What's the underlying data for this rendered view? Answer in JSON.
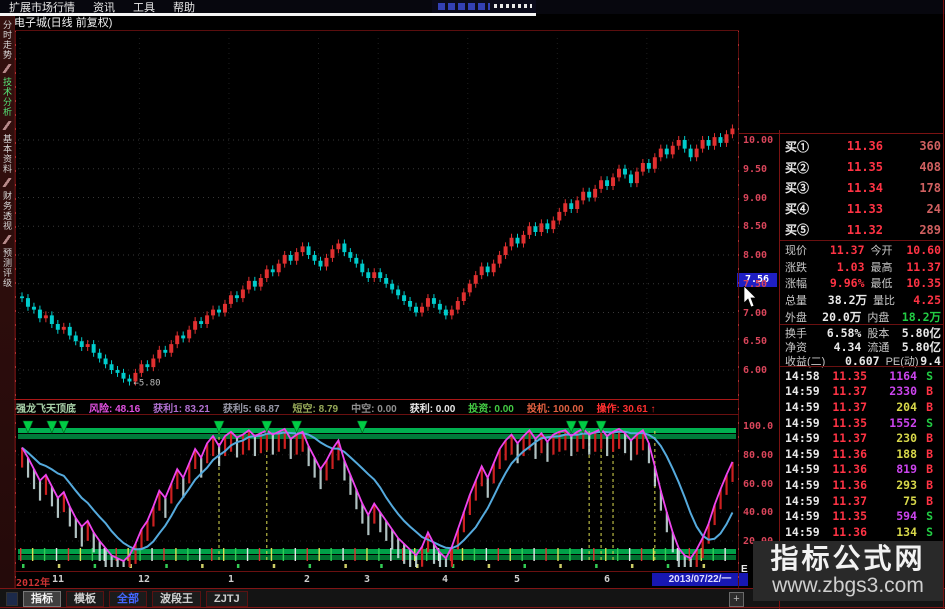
{
  "menu": [
    "扩展市场行情",
    "资讯",
    "工具",
    "帮助"
  ],
  "title_bar": {
    "stock_title": "电子城(日线 前复权)"
  },
  "sidebar": {
    "tabs": [
      {
        "label": "分时走势",
        "active": false
      },
      {
        "label": "技术分析",
        "active": true
      },
      {
        "label": "基本资料",
        "active": false
      },
      {
        "label": "财务透视",
        "active": false
      },
      {
        "label": "预测评级",
        "active": false
      }
    ]
  },
  "colors": {
    "up": "#ff3344",
    "down": "#22cc44",
    "neutral": "#e8e8e8",
    "vol_big": "#cc44ee",
    "vol_small": "#d8d84a",
    "buy_vol": "#d06060"
  },
  "chart_data": [
    {
      "type": "candlestick",
      "title": "电子城(日线 前复权)",
      "ylabel": "价格",
      "y_ticks": [
        10.0,
        9.5,
        9.0,
        8.5,
        8.0,
        7.5,
        7.0,
        6.5,
        6.0
      ],
      "y_tick_labels": [
        "10.00",
        "9.50",
        "9.00",
        "8.50",
        "8.00",
        "7.50",
        "7.00",
        "6.50",
        "6.00"
      ],
      "ylim": [
        5.6,
        11.9
      ],
      "grid": true,
      "low_annotation": {
        "label": "←5.80",
        "index": 18,
        "value": 5.8
      },
      "current_tag": {
        "label": "7.56",
        "value": 7.56
      },
      "month_start_indices": [
        0,
        20,
        35,
        50,
        60,
        75,
        90,
        105
      ],
      "closes": [
        7.25,
        7.1,
        7.05,
        6.9,
        6.95,
        6.8,
        6.7,
        6.75,
        6.6,
        6.5,
        6.4,
        6.45,
        6.3,
        6.2,
        6.1,
        6.0,
        5.95,
        5.85,
        5.8,
        5.95,
        6.1,
        6.05,
        6.2,
        6.35,
        6.3,
        6.45,
        6.6,
        6.55,
        6.7,
        6.85,
        6.8,
        6.95,
        7.05,
        7.0,
        7.15,
        7.3,
        7.25,
        7.4,
        7.55,
        7.45,
        7.6,
        7.75,
        7.7,
        7.85,
        8.0,
        7.9,
        8.05,
        8.15,
        8.0,
        7.9,
        7.8,
        7.95,
        8.1,
        8.2,
        8.05,
        7.95,
        7.85,
        7.7,
        7.6,
        7.7,
        7.6,
        7.5,
        7.4,
        7.3,
        7.2,
        7.1,
        7.0,
        7.1,
        7.25,
        7.15,
        7.05,
        6.95,
        7.05,
        7.2,
        7.35,
        7.5,
        7.65,
        7.8,
        7.7,
        7.85,
        8.0,
        8.15,
        8.3,
        8.2,
        8.35,
        8.5,
        8.4,
        8.55,
        8.45,
        8.6,
        8.75,
        8.9,
        8.8,
        8.95,
        9.1,
        9.0,
        9.15,
        9.3,
        9.2,
        9.35,
        9.5,
        9.4,
        9.25,
        9.45,
        9.6,
        9.5,
        9.7,
        9.85,
        9.75,
        9.9,
        10.0,
        9.85,
        9.7,
        9.85,
        10.0,
        9.9,
        10.05,
        9.95,
        10.1,
        10.2
      ],
      "x_ticks": [
        {
          "label": "2012年",
          "x": 2,
          "color": "#cc3333"
        },
        {
          "label": "11",
          "x": 38,
          "color": "#cfcfcf"
        },
        {
          "label": "12",
          "x": 124,
          "color": "#cfcfcf"
        },
        {
          "label": "1",
          "x": 214,
          "color": "#cfcfcf"
        },
        {
          "label": "2",
          "x": 290,
          "color": "#cfcfcf"
        },
        {
          "label": "3",
          "x": 350,
          "color": "#cfcfcf"
        },
        {
          "label": "4",
          "x": 428,
          "color": "#cfcfcf"
        },
        {
          "label": "5",
          "x": 500,
          "color": "#cfcfcf"
        },
        {
          "label": "6",
          "x": 590,
          "color": "#cfcfcf"
        }
      ],
      "date_box_label": "2013/07/22/一",
      "edge_label": "E"
    },
    {
      "type": "line+histogram",
      "title": "强龙飞天顶底",
      "y_ticks": [
        100.0,
        80.0,
        60.0,
        40.0,
        20.0
      ],
      "y_tick_labels": [
        "100.0",
        "80.00",
        "60.00",
        "40.00",
        "20.00"
      ],
      "ylim": [
        0,
        100
      ],
      "legend_position": "none",
      "series": [
        {
          "name": "操作线",
          "color": "#ee44ee",
          "values": [
            85,
            78,
            70,
            62,
            66,
            58,
            50,
            54,
            44,
            36,
            30,
            34,
            26,
            20,
            15,
            10,
            8,
            6,
            10,
            18,
            28,
            34,
            44,
            55,
            50,
            60,
            70,
            64,
            74,
            84,
            78,
            88,
            93,
            86,
            93,
            96,
            92,
            94,
            97,
            93,
            95,
            97,
            94,
            96,
            98,
            91,
            94,
            96,
            86,
            78,
            70,
            76,
            84,
            90,
            76,
            66,
            56,
            46,
            38,
            46,
            40,
            34,
            28,
            22,
            18,
            14,
            10,
            16,
            26,
            18,
            12,
            8,
            16,
            28,
            40,
            52,
            62,
            72,
            64,
            74,
            84,
            90,
            94,
            88,
            93,
            97,
            91,
            95,
            89,
            94,
            96,
            97,
            93,
            96,
            98,
            94,
            96,
            98,
            93,
            96,
            98,
            95,
            90,
            94,
            97,
            88,
            72,
            55,
            40,
            26,
            15,
            10,
            8,
            14,
            22,
            32,
            45,
            56,
            66,
            75
          ]
        },
        {
          "name": "慢线",
          "color": "#55aadd",
          "derived": "sma",
          "window": 8
        }
      ],
      "markers": {
        "sell_triangle_indices": [
          1,
          5,
          7,
          33,
          41,
          46,
          57,
          92,
          94,
          97
        ],
        "yellow_dash_indices": [
          33,
          41,
          95,
          97,
          99,
          106
        ]
      },
      "bands": {
        "top_band": true,
        "bottom_band": true
      }
    }
  ],
  "param_line": {
    "items": [
      {
        "text": "强龙飞天顶底",
        "color": "#a8d0a8"
      },
      {
        "text": "风险: 48.16",
        "color": "#e050e0"
      },
      {
        "text": "获利1: 83.21",
        "color": "#b070d0"
      },
      {
        "text": "获利5: 68.87",
        "color": "#9898a8"
      },
      {
        "text": "短空: 8.79",
        "color": "#96a858"
      },
      {
        "text": "中空: 0.00",
        "color": "#909090"
      },
      {
        "text": "获利: 0.00",
        "color": "#e8e8e8"
      },
      {
        "text": "投资: 0.00",
        "color": "#44cc44"
      },
      {
        "text": "投机: 100.00",
        "color": "#e06040"
      },
      {
        "text": "操作: 30.61 ↑",
        "color": "#ff3030"
      }
    ]
  },
  "right_panel": {
    "buy_rows": [
      {
        "label": "买①",
        "price": "11.36",
        "vol": "360"
      },
      {
        "label": "买②",
        "price": "11.35",
        "vol": "408"
      },
      {
        "label": "买③",
        "price": "11.34",
        "vol": "178"
      },
      {
        "label": "买④",
        "price": "11.33",
        "vol": "24"
      },
      {
        "label": "买⑤",
        "price": "11.32",
        "vol": "289"
      }
    ],
    "info_rows": [
      {
        "l1": "现价",
        "v1": "11.37",
        "c1": "up",
        "l2": "今开",
        "v2": "10.60",
        "c2": "up"
      },
      {
        "l1": "涨跌",
        "v1": "1.03",
        "c1": "up",
        "l2": "最高",
        "v2": "11.37",
        "c2": "up"
      },
      {
        "l1": "涨幅",
        "v1": "9.96%",
        "c1": "up",
        "l2": "最低",
        "v2": "10.35",
        "c2": "up"
      },
      {
        "l1": "总量",
        "v1": "38.2万",
        "c1": "neutral",
        "l2": "量比",
        "v2": "4.25",
        "c2": "up"
      },
      {
        "l1": "外盘",
        "v1": "20.0万",
        "c1": "neutral",
        "l2": "内盘",
        "v2": "18.2万",
        "c2": "down"
      }
    ],
    "info_rows2": [
      {
        "l1": "换手",
        "v1": "6.58%",
        "c1": "neutral",
        "l2": "股本",
        "v2": "5.80亿",
        "c2": "neutral"
      },
      {
        "l1": "净资",
        "v1": "4.34",
        "c1": "neutral",
        "l2": "流通",
        "v2": "5.80亿",
        "c2": "neutral"
      },
      {
        "l1": "收益(二)",
        "v1": "0.607",
        "c1": "neutral",
        "l2": "PE(动)",
        "v2": "9.4",
        "c2": "neutral"
      }
    ],
    "transactions": [
      {
        "time": "14:58",
        "price": "11.35",
        "vol": 1164,
        "side": "S"
      },
      {
        "time": "14:59",
        "price": "11.37",
        "vol": 2330,
        "side": "B"
      },
      {
        "time": "14:59",
        "price": "11.37",
        "vol": 204,
        "side": "B"
      },
      {
        "time": "14:59",
        "price": "11.35",
        "vol": 1552,
        "side": "S"
      },
      {
        "time": "14:59",
        "price": "11.37",
        "vol": 230,
        "side": "B"
      },
      {
        "time": "14:59",
        "price": "11.36",
        "vol": 188,
        "side": "B"
      },
      {
        "time": "14:59",
        "price": "11.36",
        "vol": 819,
        "side": "B"
      },
      {
        "time": "14:59",
        "price": "11.36",
        "vol": 293,
        "side": "B"
      },
      {
        "time": "14:59",
        "price": "11.37",
        "vol": 75,
        "side": "B"
      },
      {
        "time": "14:59",
        "price": "11.35",
        "vol": 594,
        "side": "S"
      },
      {
        "time": "14:59",
        "price": "11.36",
        "vol": 134,
        "side": "S"
      }
    ]
  },
  "watermark": {
    "line1": "指标公式网",
    "line2": "www.zbgs3.com"
  },
  "tab_bar": {
    "tabs": [
      {
        "label": "指标",
        "state": "pressed"
      },
      {
        "label": "模板",
        "state": "normal"
      },
      {
        "label": "全部",
        "state": "blue"
      },
      {
        "label": "波段王",
        "state": "normal"
      },
      {
        "label": "ZJTJ",
        "state": "normal"
      }
    ],
    "plus_label": "+"
  }
}
